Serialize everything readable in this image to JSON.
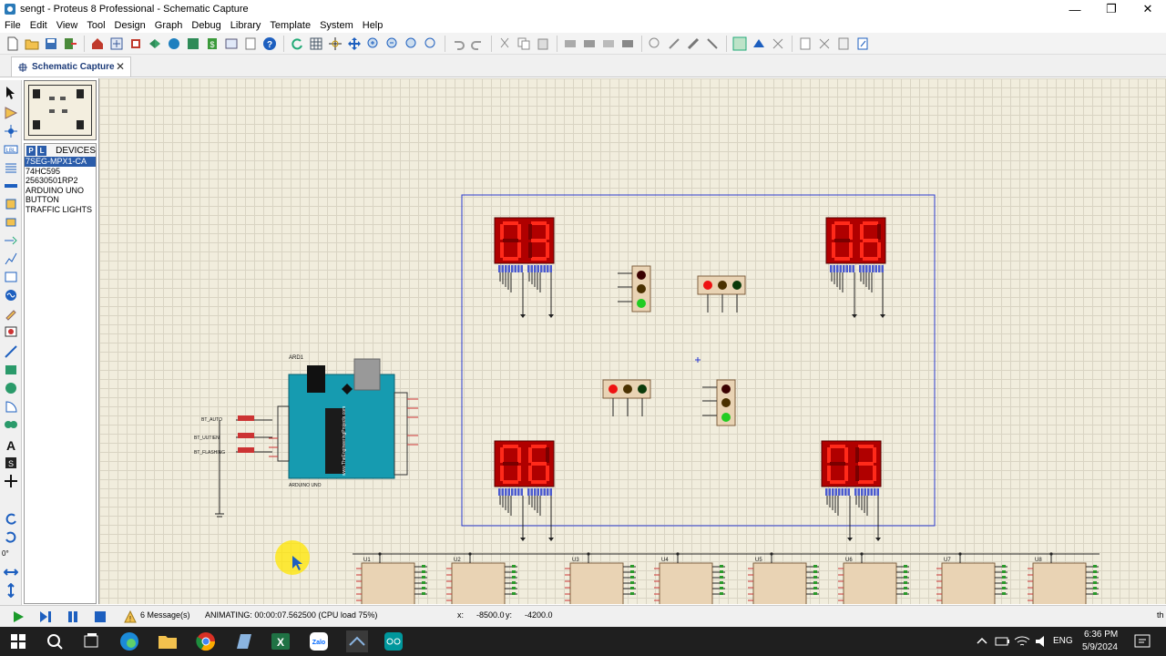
{
  "window": {
    "title": "sengt - Proteus 8 Professional - Schematic Capture",
    "minimize": "—",
    "maximize": "❐",
    "close": "✕"
  },
  "menu": [
    "File",
    "Edit",
    "View",
    "Tool",
    "Design",
    "Graph",
    "Debug",
    "Library",
    "Template",
    "System",
    "Help"
  ],
  "tab": {
    "label": "Schematic Capture",
    "close": "✕"
  },
  "devices": {
    "P": "P",
    "L": "L",
    "header": "DEVICES",
    "items": [
      "7SEG-MPX1-CA",
      "74HC595",
      "25630501RP2",
      "ARDUINO UNO",
      "BUTTON",
      "TRAFFIC LIGHTS"
    ],
    "selected_index": 0
  },
  "left_angle": "0°",
  "schematic": {
    "displays": [
      "03",
      "06",
      "06",
      "03"
    ],
    "arduino_ref": "ARD1",
    "arduino_sub": "ARDUINO UNO",
    "arduino_brand": "www.TheEngineeringProjects.com",
    "buttons": [
      "BT_AUTO",
      "BT_UUTIEN",
      "BT_FLASHING"
    ],
    "chips": [
      "U1",
      "U2",
      "U3",
      "U4",
      "U5",
      "U6",
      "U7",
      "U8"
    ]
  },
  "status": {
    "messages": "6 Message(s)",
    "animating": "ANIMATING: 00:00:07.562500 (CPU load 75%)",
    "x_label": "x:",
    "x_value": "-8500.0",
    "y_label": "y:",
    "y_value": "-4200.0",
    "units": "th"
  },
  "taskbar": {
    "lang": "ENG",
    "time": "6:36 PM",
    "date": "5/9/2024"
  },
  "colors": {
    "seg_on": "#ff2a1a",
    "seg_off": "#7a0000",
    "display_bg": "#b00000",
    "arduino": "#169bb0",
    "selection": "#2a5caa"
  }
}
